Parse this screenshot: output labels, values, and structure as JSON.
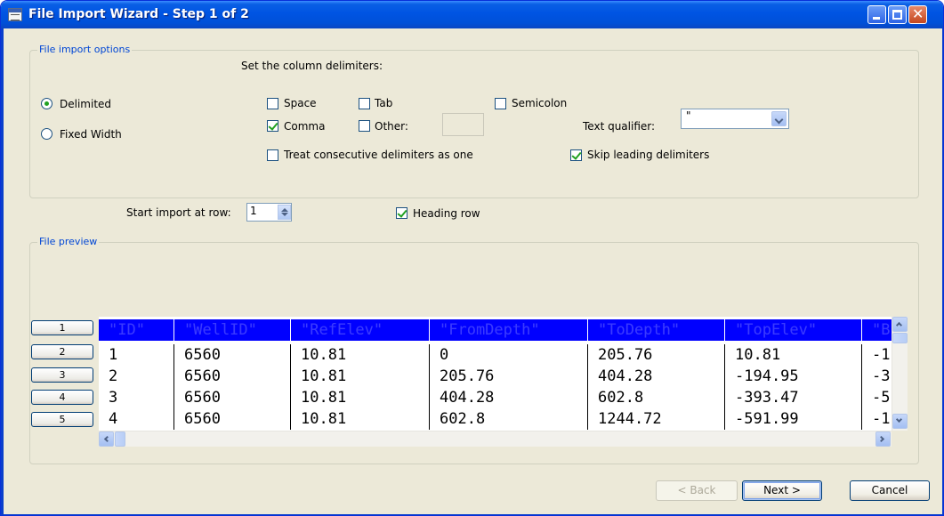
{
  "window": {
    "title": "File Import Wizard - Step 1 of 2"
  },
  "options": {
    "group_label": "File import options",
    "delimiters_heading": "Set the column delimiters:",
    "format": {
      "delimited": "Delimited",
      "fixed_width": "Fixed Width",
      "selected": "Delimited"
    },
    "delimiters": {
      "space": {
        "label": "Space",
        "checked": false
      },
      "tab": {
        "label": "Tab",
        "checked": false
      },
      "semicolon": {
        "label": "Semicolon",
        "checked": false
      },
      "comma": {
        "label": "Comma",
        "checked": true
      },
      "other": {
        "label": "Other:",
        "checked": false,
        "value": ""
      }
    },
    "text_qualifier": {
      "label": "Text qualifier:",
      "value": "\""
    },
    "consecutive": {
      "label": "Treat consecutive delimiters as one",
      "checked": false
    },
    "skip_leading": {
      "label": "Skip leading delimiters",
      "checked": true
    },
    "start_row": {
      "label": "Start import at row:",
      "value": "1"
    },
    "heading_row": {
      "label": "Heading row",
      "checked": true
    }
  },
  "preview": {
    "group_label": "File preview",
    "row_numbers": [
      "1",
      "2",
      "3",
      "4",
      "5"
    ],
    "columns": [
      "\"ID\"",
      "\"WellID\"",
      "\"RefElev\"",
      "\"FromDepth\"",
      "\"ToDepth\"",
      "\"TopElev\"",
      "\"B"
    ],
    "rows": [
      [
        "1",
        "6560",
        "10.81",
        "0",
        "205.76",
        "10.81",
        "-1"
      ],
      [
        "2",
        "6560",
        "10.81",
        "205.76",
        "404.28",
        "-194.95",
        "-3"
      ],
      [
        "3",
        "6560",
        "10.81",
        "404.28",
        "602.8",
        "-393.47",
        "-5"
      ],
      [
        "4",
        "6560",
        "10.81",
        "602.8",
        "1244.72",
        "-591.99",
        "-1"
      ]
    ]
  },
  "buttons": {
    "back": "< Back",
    "next": "Next >",
    "cancel": "Cancel"
  },
  "colors": {
    "title_bar": "#0054e3",
    "group_label": "#0046d5",
    "preview_header": "#0000ff",
    "check_mark": "#21a121"
  }
}
